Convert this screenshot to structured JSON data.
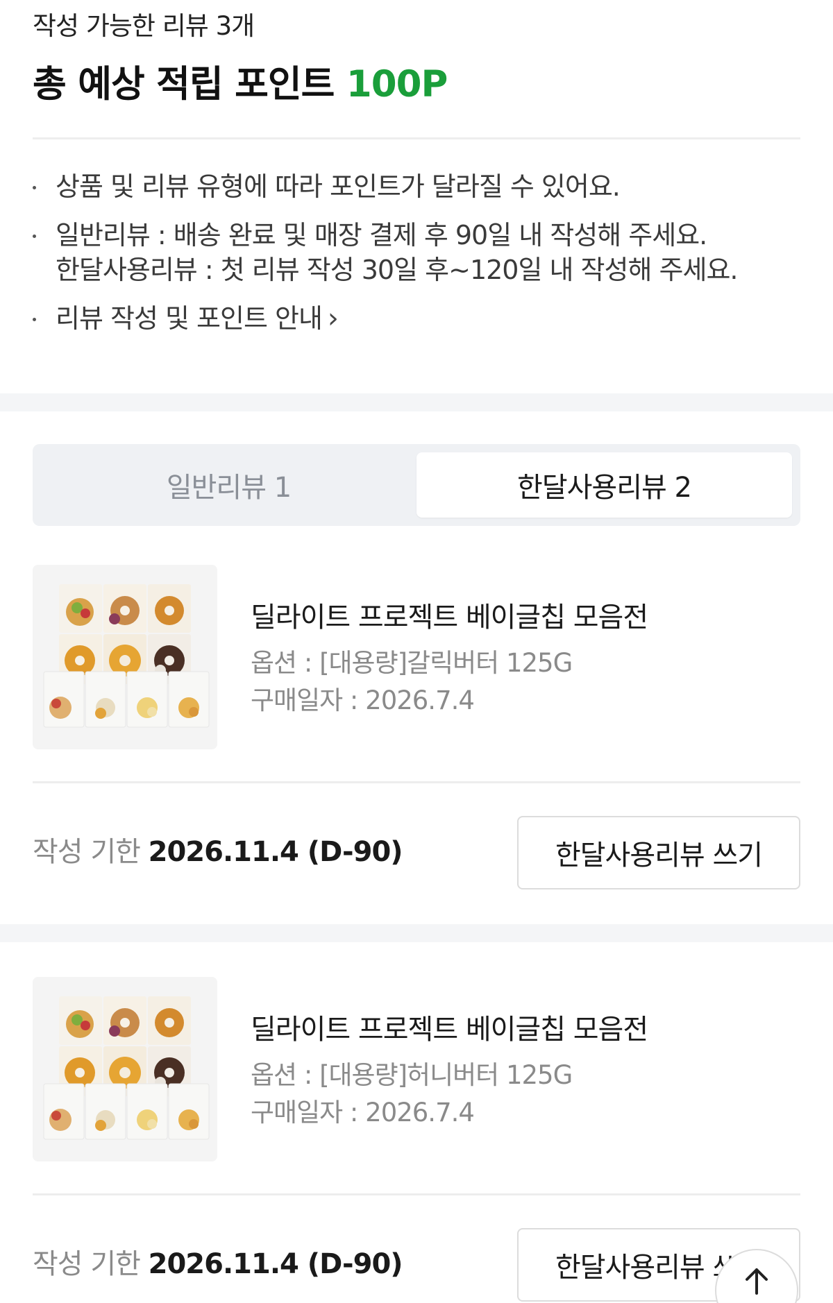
{
  "summary": {
    "subtitle": "작성 가능한 리뷰 3개",
    "title_prefix": "총 예상 적립 포인트",
    "points": "100P"
  },
  "notices": {
    "item1": "상품 및 리뷰 유형에 따라 포인트가 달라질 수 있어요.",
    "item2_line1": "일반리뷰 : 배송 완료 및 매장 결제 후 90일 내 작성해 주세요.",
    "item2_line2": "한달사용리뷰 : 첫 리뷰 작성 30일 후~120일 내 작성해 주세요.",
    "item3_link": "리뷰 작성 및 포인트 안내",
    "item3_chevron": "›"
  },
  "tabs": [
    {
      "label": "일반리뷰 1",
      "active": false
    },
    {
      "label": "한달사용리뷰 2",
      "active": true
    }
  ],
  "reviews": [
    {
      "name": "딜라이트 프로젝트 베이글칩 모음전",
      "option": "옵션 : [대용량]갈릭버터 125G",
      "purchase_date": "구매일자 : 2026.7.4",
      "deadline_label": "작성 기한",
      "deadline_value": "2026.11.4 (D-90)",
      "button": "한달사용리뷰 쓰기"
    },
    {
      "name": "딜라이트 프로젝트 베이글칩 모음전",
      "option": "옵션 : [대용량]허니버터 125G",
      "purchase_date": "구매일자 : 2026.7.4",
      "deadline_label": "작성 기한",
      "deadline_value": "2026.11.4 (D-90)",
      "button": "한달사용리뷰 쓰기"
    }
  ],
  "colors": {
    "points_accent": "#1a9e3a",
    "band_bg": "#f4f5f7",
    "tab_bg": "#eff1f4"
  },
  "icons": {
    "chevron": "chevron-right-icon",
    "scroll_top": "arrow-up-icon",
    "product": "bagel-chip-pack-image"
  }
}
